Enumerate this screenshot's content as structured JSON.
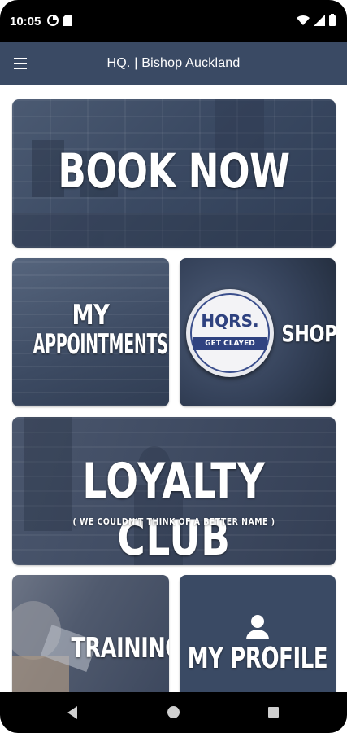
{
  "status_bar": {
    "time": "10:05",
    "left_icons": [
      "data-saver-icon",
      "sd-card-icon"
    ],
    "right_icons": [
      "wifi-icon",
      "signal-icon",
      "battery-icon"
    ]
  },
  "app_bar": {
    "title": "HQ. | Bishop Auckland",
    "menu_icon": "hamburger-menu-icon",
    "background": "#3a4a64"
  },
  "tiles": {
    "book_now": {
      "title": "BOOK NOW"
    },
    "my_appointments": {
      "title_line1": "MY",
      "title_line2": "APPOINTMENTS"
    },
    "shop": {
      "title": "SHOP",
      "product_brand": "HQRS.",
      "product_band": "GET CLAYED"
    },
    "loyalty_club": {
      "title": "LOYALTY CLUB",
      "subtitle": "( WE COULDN'T THINK OF A BETTER NAME )"
    },
    "training": {
      "title": "TRAINING"
    },
    "my_profile": {
      "title": "MY PROFILE",
      "icon": "person-icon"
    }
  },
  "nav_bar": {
    "icons": [
      "back-icon",
      "home-icon",
      "recents-icon"
    ]
  }
}
